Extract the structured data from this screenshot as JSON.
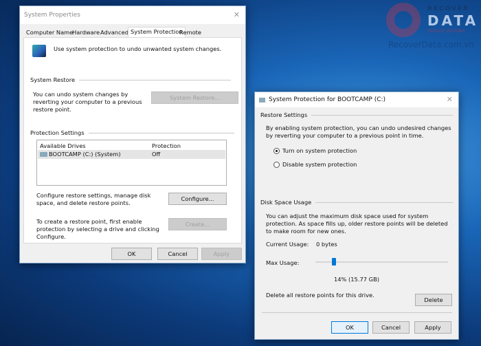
{
  "watermark": {
    "brand_top": "RECOVER",
    "brand_main": "DATA",
    "brand_sub": "SERVICE VIETNAM",
    "url": "RecoverData.com.vn"
  },
  "sysprops": {
    "title": "System Properties",
    "tabs": [
      "Computer Name",
      "Hardware",
      "Advanced",
      "System Protection",
      "Remote"
    ],
    "active_tab": "System Protection",
    "intro": "Use system protection to undo unwanted system changes.",
    "system_restore_group": "System Restore",
    "system_restore_text": "You can undo system changes by reverting your computer to a previous restore point.",
    "system_restore_button": "System Restore...",
    "protection_group": "Protection Settings",
    "columns": [
      "Available Drives",
      "Protection"
    ],
    "drives": [
      {
        "name": "BOOTCAMP (C:) (System)",
        "protection": "Off"
      }
    ],
    "configure_text": "Configure restore settings, manage disk space, and delete restore points.",
    "configure_button": "Configure...",
    "create_text": "To create a restore point, first enable protection by selecting a drive and clicking Configure.",
    "create_button": "Create...",
    "ok": "OK",
    "cancel": "Cancel",
    "apply": "Apply"
  },
  "protect": {
    "title": "System Protection for BOOTCAMP (C:)",
    "restore_group": "Restore Settings",
    "restore_text": "By enabling system protection, you can undo undesired changes by reverting your computer to a previous point in time.",
    "radio_on": "Turn on system protection",
    "radio_off": "Disable system protection",
    "selected": "on",
    "disk_group": "Disk Space Usage",
    "disk_text": "You can adjust the maximum disk space used for system protection. As space fills up, older restore points will be deleted to make room for new ones.",
    "current_label": "Current Usage:",
    "current_value": "0 bytes",
    "max_label": "Max Usage:",
    "max_percent": 14,
    "max_value": "14% (15.77 GB)",
    "delete_text": "Delete all restore points for this drive.",
    "delete_button": "Delete",
    "ok": "OK",
    "cancel": "Cancel",
    "apply": "Apply"
  }
}
